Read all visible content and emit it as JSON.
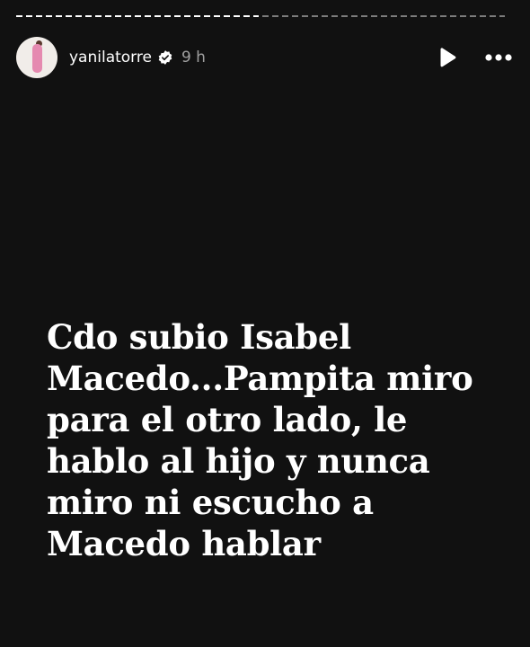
{
  "story": {
    "username": "yanilatorre",
    "time_ago": "9 h",
    "text": "Cdo subio Isabel\nMacedo...Pampita miro\npara el otro lado, le\nhablo al hijo y nunca\nmiro ni escucho a\nMacedo hablar",
    "progress_segments": [
      {
        "state": "viewed"
      },
      {
        "state": "upcoming"
      }
    ]
  },
  "icons": {
    "verified": "verified-badge-icon",
    "play": "play-icon",
    "more": "more-options-icon"
  },
  "colors": {
    "background": "#111111",
    "text": "#ffffff"
  }
}
